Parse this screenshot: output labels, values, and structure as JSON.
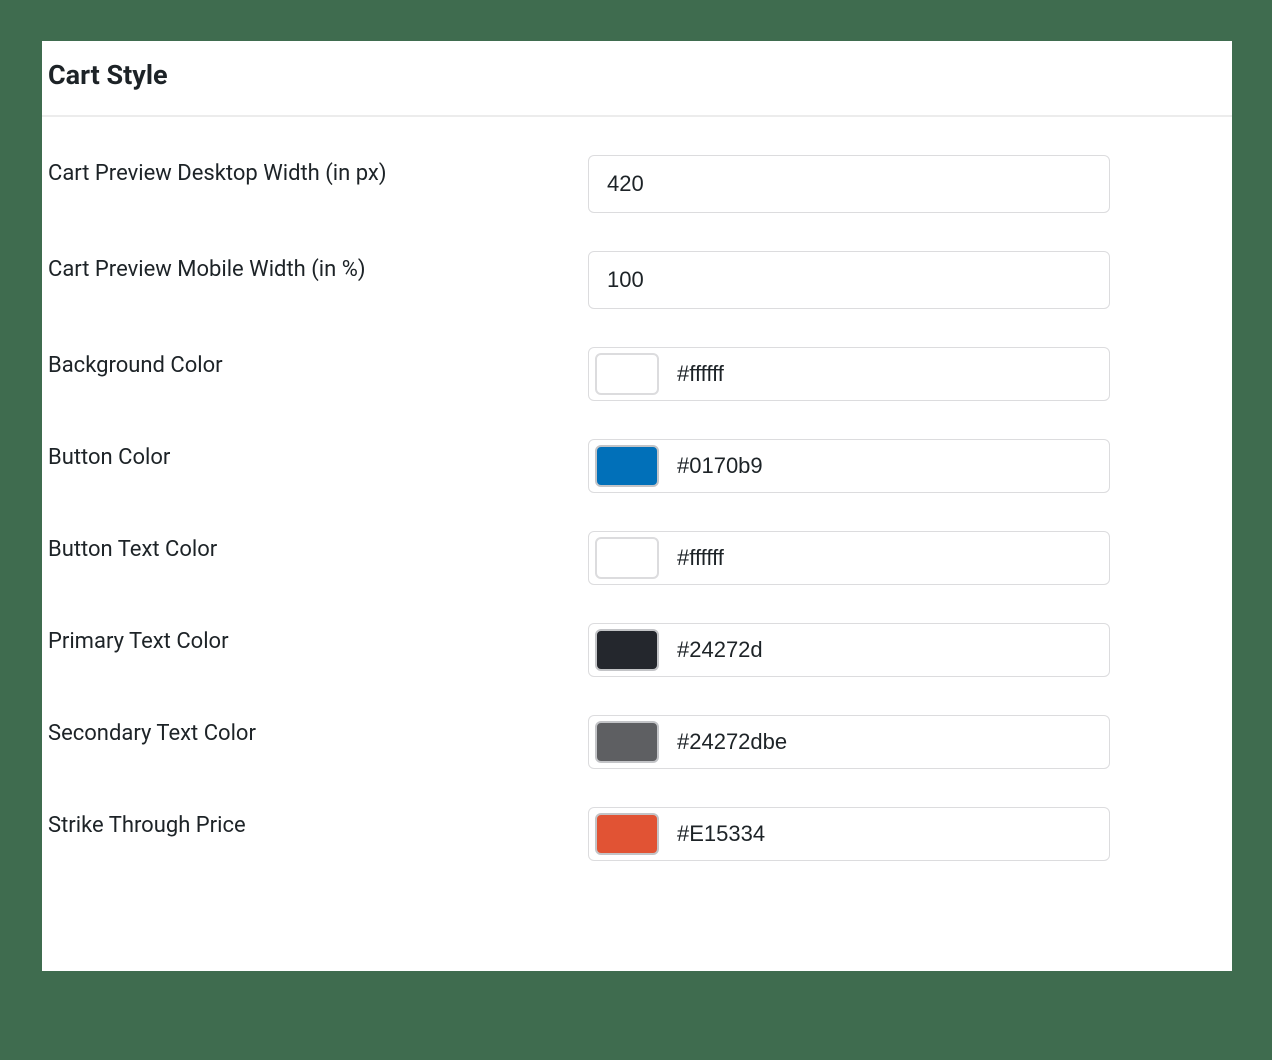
{
  "section_title": "Cart Style",
  "fields": {
    "desktop_width": {
      "label": "Cart Preview Desktop Width (in px)",
      "value": "420"
    },
    "mobile_width": {
      "label": "Cart Preview Mobile Width (in %)",
      "value": "100"
    },
    "background_color": {
      "label": "Background Color",
      "value": "#ffffff",
      "swatch": "#ffffff"
    },
    "button_color": {
      "label": "Button Color",
      "value": "#0170b9",
      "swatch": "#0170b9"
    },
    "button_text_color": {
      "label": "Button Text Color",
      "value": "#ffffff",
      "swatch": "#ffffff"
    },
    "primary_text_color": {
      "label": "Primary Text Color",
      "value": "#24272d",
      "swatch": "#24272d"
    },
    "secondary_text_color": {
      "label": "Secondary Text Color",
      "value": "#24272dbe",
      "swatch": "#5e5f62"
    },
    "strike_through_price": {
      "label": "Strike Through Price",
      "value": "#E15334",
      "swatch": "#E15334"
    }
  }
}
